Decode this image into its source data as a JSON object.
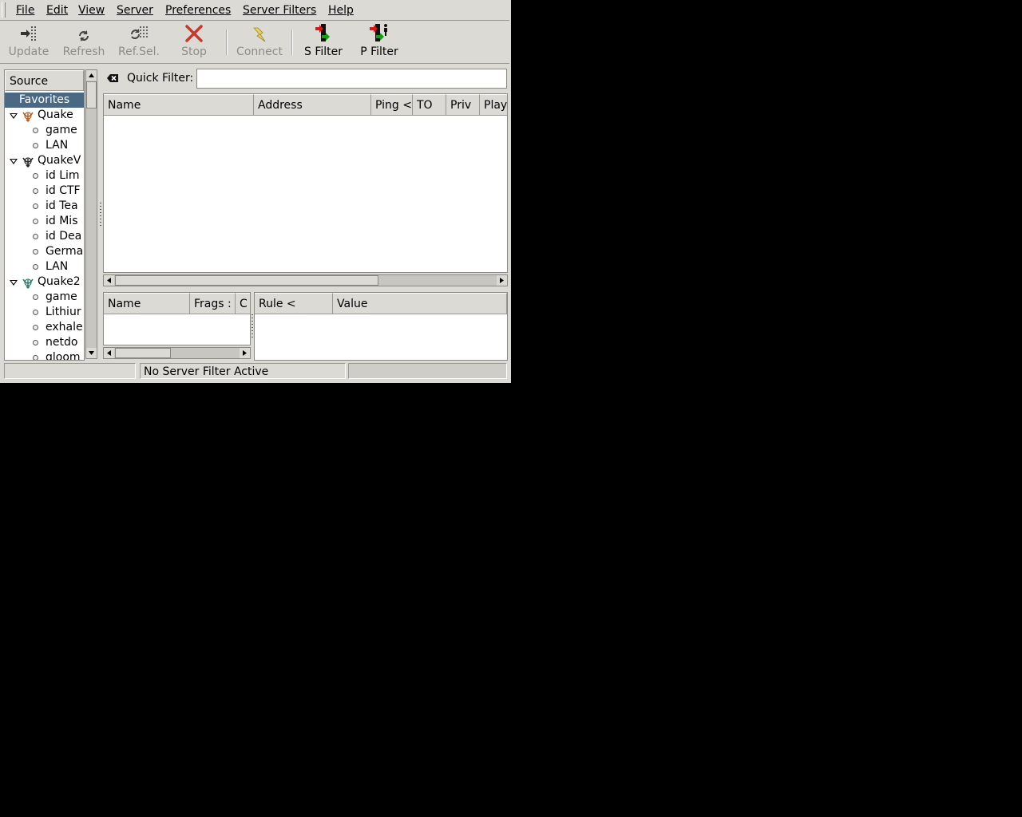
{
  "menubar": {
    "items": [
      {
        "label": "File"
      },
      {
        "label": "Edit"
      },
      {
        "label": "View"
      },
      {
        "label": "Server"
      },
      {
        "label": "Preferences"
      },
      {
        "label": "Server Filters"
      },
      {
        "label": "Help"
      }
    ]
  },
  "toolbar": {
    "update_label": "Update",
    "refresh_label": "Refresh",
    "refsel_label": "Ref.Sel.",
    "stop_label": "Stop",
    "connect_label": "Connect",
    "sfilter_label": "S Filter",
    "pfilter_label": "P Filter"
  },
  "source": {
    "header": "Source",
    "items": [
      {
        "label": "Favorites",
        "kind": "selected"
      },
      {
        "label": "Quake",
        "kind": "group",
        "icon": "quake-icon"
      },
      {
        "label": "game",
        "kind": "leaf"
      },
      {
        "label": "LAN",
        "kind": "leaf"
      },
      {
        "label": "QuakeV",
        "kind": "group",
        "icon": "quakeworld-icon"
      },
      {
        "label": "id Lim",
        "kind": "leaf"
      },
      {
        "label": "id CTF",
        "kind": "leaf"
      },
      {
        "label": "id Tea",
        "kind": "leaf"
      },
      {
        "label": "id Mis",
        "kind": "leaf"
      },
      {
        "label": "id Dea",
        "kind": "leaf"
      },
      {
        "label": "Germa",
        "kind": "leaf"
      },
      {
        "label": "LAN",
        "kind": "leaf"
      },
      {
        "label": "Quake2",
        "kind": "group",
        "icon": "quake2-icon"
      },
      {
        "label": "game",
        "kind": "leaf"
      },
      {
        "label": "Lithiur",
        "kind": "leaf"
      },
      {
        "label": "exhale",
        "kind": "leaf"
      },
      {
        "label": "netdo",
        "kind": "leaf"
      },
      {
        "label": "gloom",
        "kind": "leaf"
      }
    ]
  },
  "quickfilter": {
    "label": "Quick Filter:",
    "value": ""
  },
  "serverlist": {
    "columns": [
      "Name",
      "Address",
      "Ping <",
      "TO",
      "Priv",
      "Play"
    ]
  },
  "playerlist": {
    "columns": [
      "Name",
      "Frags :",
      "C"
    ]
  },
  "rulelist": {
    "columns": [
      "Rule <",
      "Value"
    ]
  },
  "statusbar": {
    "left": "",
    "middle": "No Server Filter Active",
    "right": ""
  }
}
